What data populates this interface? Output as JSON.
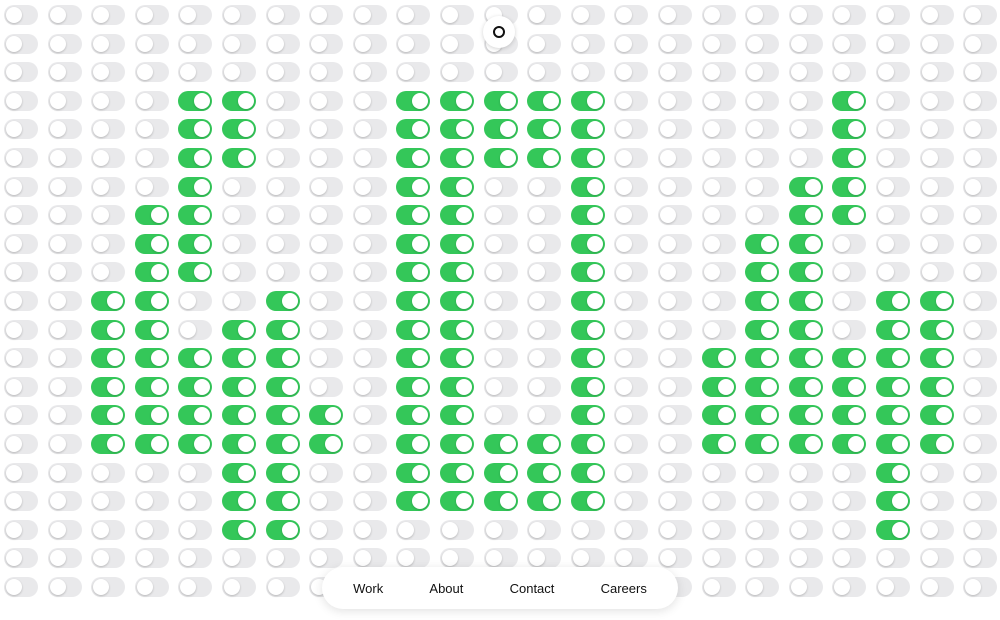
{
  "colors": {
    "on": "#34c759",
    "off": "#e9e9eb",
    "knob": "#ffffff"
  },
  "toggle_grid": {
    "columns": 23,
    "rows": 21,
    "on_cells": [
      [
        3,
        4
      ],
      [
        3,
        5
      ],
      [
        4,
        4
      ],
      [
        4,
        5
      ],
      [
        5,
        4
      ],
      [
        5,
        5
      ],
      [
        6,
        4
      ],
      [
        7,
        3
      ],
      [
        7,
        4
      ],
      [
        8,
        3
      ],
      [
        8,
        4
      ],
      [
        9,
        3
      ],
      [
        9,
        4
      ],
      [
        10,
        2
      ],
      [
        10,
        3
      ],
      [
        10,
        6
      ],
      [
        11,
        2
      ],
      [
        11,
        3
      ],
      [
        11,
        5
      ],
      [
        11,
        6
      ],
      [
        12,
        2
      ],
      [
        12,
        3
      ],
      [
        12,
        4
      ],
      [
        12,
        5
      ],
      [
        12,
        6
      ],
      [
        13,
        2
      ],
      [
        13,
        3
      ],
      [
        13,
        4
      ],
      [
        13,
        5
      ],
      [
        13,
        6
      ],
      [
        14,
        2
      ],
      [
        14,
        3
      ],
      [
        14,
        4
      ],
      [
        14,
        5
      ],
      [
        14,
        6
      ],
      [
        14,
        7
      ],
      [
        15,
        2
      ],
      [
        15,
        3
      ],
      [
        15,
        4
      ],
      [
        15,
        5
      ],
      [
        15,
        6
      ],
      [
        15,
        7
      ],
      [
        16,
        5
      ],
      [
        16,
        6
      ],
      [
        17,
        5
      ],
      [
        17,
        6
      ],
      [
        18,
        5
      ],
      [
        18,
        6
      ],
      [
        3,
        9
      ],
      [
        3,
        10
      ],
      [
        3,
        11
      ],
      [
        3,
        12
      ],
      [
        3,
        13
      ],
      [
        4,
        9
      ],
      [
        4,
        10
      ],
      [
        4,
        11
      ],
      [
        4,
        12
      ],
      [
        4,
        13
      ],
      [
        5,
        9
      ],
      [
        5,
        10
      ],
      [
        5,
        11
      ],
      [
        5,
        12
      ],
      [
        5,
        13
      ],
      [
        6,
        9
      ],
      [
        6,
        10
      ],
      [
        6,
        13
      ],
      [
        7,
        9
      ],
      [
        7,
        10
      ],
      [
        7,
        13
      ],
      [
        8,
        9
      ],
      [
        8,
        10
      ],
      [
        8,
        13
      ],
      [
        9,
        9
      ],
      [
        9,
        10
      ],
      [
        9,
        13
      ],
      [
        10,
        9
      ],
      [
        10,
        10
      ],
      [
        10,
        13
      ],
      [
        11,
        9
      ],
      [
        11,
        10
      ],
      [
        11,
        13
      ],
      [
        12,
        9
      ],
      [
        12,
        10
      ],
      [
        12,
        13
      ],
      [
        13,
        9
      ],
      [
        13,
        10
      ],
      [
        13,
        13
      ],
      [
        14,
        9
      ],
      [
        14,
        10
      ],
      [
        14,
        13
      ],
      [
        15,
        9
      ],
      [
        15,
        10
      ],
      [
        15,
        11
      ],
      [
        15,
        12
      ],
      [
        15,
        13
      ],
      [
        16,
        9
      ],
      [
        16,
        10
      ],
      [
        16,
        11
      ],
      [
        16,
        12
      ],
      [
        16,
        13
      ],
      [
        17,
        9
      ],
      [
        17,
        10
      ],
      [
        17,
        11
      ],
      [
        17,
        12
      ],
      [
        17,
        13
      ],
      [
        3,
        19
      ],
      [
        4,
        19
      ],
      [
        5,
        19
      ],
      [
        6,
        18
      ],
      [
        6,
        19
      ],
      [
        7,
        18
      ],
      [
        7,
        19
      ],
      [
        8,
        17
      ],
      [
        8,
        18
      ],
      [
        9,
        17
      ],
      [
        9,
        18
      ],
      [
        10,
        17
      ],
      [
        10,
        18
      ],
      [
        10,
        20
      ],
      [
        10,
        21
      ],
      [
        11,
        17
      ],
      [
        11,
        18
      ],
      [
        11,
        20
      ],
      [
        11,
        21
      ],
      [
        12,
        16
      ],
      [
        12,
        17
      ],
      [
        12,
        18
      ],
      [
        12,
        19
      ],
      [
        12,
        20
      ],
      [
        12,
        21
      ],
      [
        13,
        16
      ],
      [
        13,
        17
      ],
      [
        13,
        18
      ],
      [
        13,
        19
      ],
      [
        13,
        20
      ],
      [
        13,
        21
      ],
      [
        14,
        16
      ],
      [
        14,
        17
      ],
      [
        14,
        18
      ],
      [
        14,
        19
      ],
      [
        14,
        20
      ],
      [
        14,
        21
      ],
      [
        15,
        16
      ],
      [
        15,
        17
      ],
      [
        15,
        18
      ],
      [
        15,
        19
      ],
      [
        15,
        20
      ],
      [
        15,
        21
      ],
      [
        16,
        20
      ],
      [
        17,
        20
      ],
      [
        18,
        20
      ]
    ]
  },
  "nav": {
    "work": "Work",
    "about": "About",
    "contact": "Contact",
    "careers": "Careers"
  }
}
